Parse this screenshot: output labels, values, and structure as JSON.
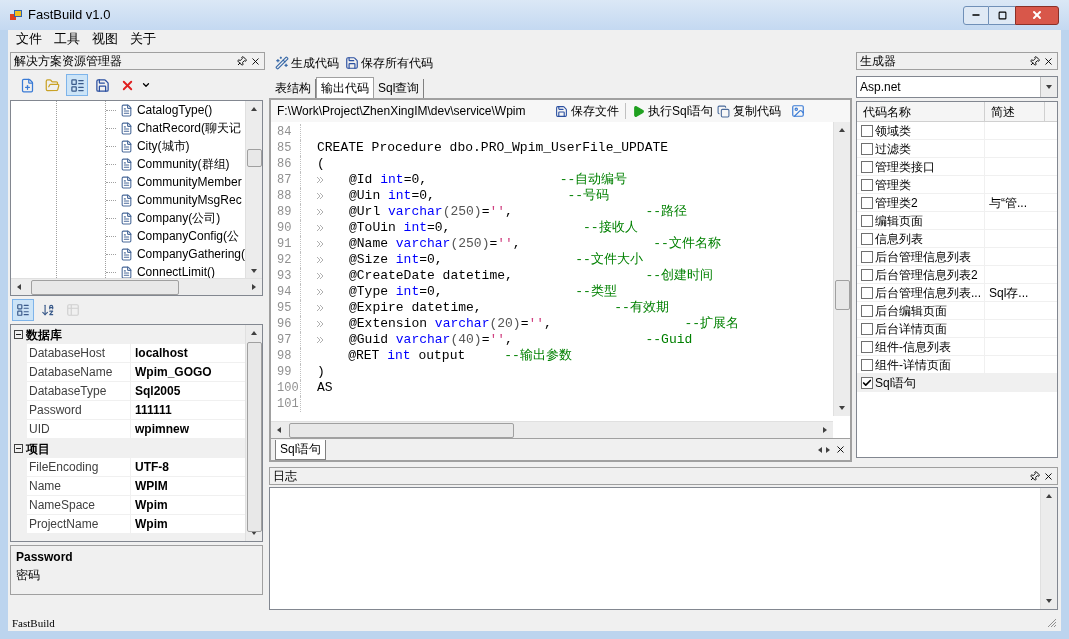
{
  "window": {
    "title": "FastBuild v1.0"
  },
  "menu": [
    "文件",
    "工具",
    "视图",
    "关于"
  ],
  "solution_explorer": {
    "title": "解决方案资源管理器",
    "toolbar": [
      {
        "kind": "new-project",
        "selected": false
      },
      {
        "kind": "open-folder",
        "selected": false
      },
      {
        "kind": "properties",
        "selected": true
      },
      {
        "kind": "save",
        "selected": false
      },
      {
        "kind": "delete",
        "selected": false
      }
    ],
    "tree_items": [
      "CatalogType()",
      "ChatRecord(聊天记",
      "City(城市)",
      "Community(群组)",
      "CommunityMember",
      "CommunityMsgRec",
      "Company(公司)",
      "CompanyConfig(公",
      "CompanyGathering(",
      "ConnectLimit()"
    ]
  },
  "properties": {
    "toolbar": [
      {
        "kind": "categorized",
        "selected": true,
        "disabled": false
      },
      {
        "kind": "alphabetical",
        "selected": false,
        "disabled": false
      },
      {
        "kind": "property-pages",
        "selected": false,
        "disabled": true
      }
    ],
    "categories": [
      {
        "name": "数据库",
        "expanded": true,
        "rows": [
          {
            "name": "DatabaseHost",
            "value": "localhost"
          },
          {
            "name": "DatabaseName",
            "value": "Wpim_GOGO"
          },
          {
            "name": "DatabaseType",
            "value": "Sql2005"
          },
          {
            "name": "Password",
            "value": "111111"
          },
          {
            "name": "UID",
            "value": "wpimnew"
          }
        ]
      },
      {
        "name": "项目",
        "expanded": true,
        "rows": [
          {
            "name": "FileEncoding",
            "value": "UTF-8"
          },
          {
            "name": "Name",
            "value": "WPIM"
          },
          {
            "name": "NameSpace",
            "value": "Wpim"
          },
          {
            "name": "ProjectName",
            "value": "Wpim"
          }
        ]
      }
    ],
    "description": {
      "title": "Password",
      "text": "密码"
    }
  },
  "main_toolbar": [
    {
      "kind": "generate",
      "label": "生成代码"
    },
    {
      "kind": "save-all",
      "label": "保存所有代码"
    }
  ],
  "tabs": [
    {
      "label": "表结构",
      "selected": false
    },
    {
      "label": "输出代码",
      "selected": true
    },
    {
      "label": "Sql查询",
      "selected": false
    }
  ],
  "editor": {
    "path": "F:\\Work\\Project\\ZhenXingIM\\dev\\service\\Wpim",
    "toolbar": [
      {
        "kind": "save",
        "label": "保存文件"
      },
      {
        "kind": "run",
        "label": "执行Sql语句"
      },
      {
        "kind": "copy",
        "label": "复制代码"
      },
      {
        "kind": "image"
      }
    ],
    "lines": [
      {
        "number": "84",
        "tab": false
      },
      {
        "number": "85",
        "tab": false,
        "tokens": [
          {
            "kind": "plain",
            "text": "CREATE Procedure dbo.PRO_Wpim_UserFile_UPDATE"
          }
        ]
      },
      {
        "number": "86",
        "tab": false,
        "tokens": [
          {
            "kind": "plain",
            "text": "("
          }
        ]
      },
      {
        "number": "87",
        "tab": true,
        "tokens": [
          {
            "kind": "plain",
            "text": "@Id "
          },
          {
            "kind": "keyword",
            "text": "int"
          },
          {
            "kind": "plain",
            "text": "=0,"
          }
        ],
        "comment": "                 --自动编号"
      },
      {
        "number": "88",
        "tab": true,
        "tokens": [
          {
            "kind": "plain",
            "text": "@Uin "
          },
          {
            "kind": "keyword",
            "text": "int"
          },
          {
            "kind": "plain",
            "text": "=0,"
          }
        ],
        "comment": "                 --号码"
      },
      {
        "number": "89",
        "tab": true,
        "tokens": [
          {
            "kind": "plain",
            "text": "@Url "
          },
          {
            "kind": "keyword",
            "text": "varchar"
          },
          {
            "kind": "number",
            "text": "(250)"
          },
          {
            "kind": "plain",
            "text": "="
          },
          {
            "kind": "string",
            "text": "''"
          },
          {
            "kind": "plain",
            "text": ","
          }
        ],
        "comment": "                 --路径"
      },
      {
        "number": "90",
        "tab": true,
        "tokens": [
          {
            "kind": "plain",
            "text": "@ToUin "
          },
          {
            "kind": "keyword",
            "text": "int"
          },
          {
            "kind": "plain",
            "text": "=0,"
          }
        ],
        "comment": "                 --接收人"
      },
      {
        "number": "91",
        "tab": true,
        "tokens": [
          {
            "kind": "plain",
            "text": "@Name "
          },
          {
            "kind": "keyword",
            "text": "varchar"
          },
          {
            "kind": "number",
            "text": "(250)"
          },
          {
            "kind": "plain",
            "text": "="
          },
          {
            "kind": "string",
            "text": "''"
          },
          {
            "kind": "plain",
            "text": ","
          }
        ],
        "comment": "                 --文件名称"
      },
      {
        "number": "92",
        "tab": true,
        "tokens": [
          {
            "kind": "plain",
            "text": "@Size "
          },
          {
            "kind": "keyword",
            "text": "int"
          },
          {
            "kind": "plain",
            "text": "=0,"
          }
        ],
        "comment": "                 --文件大小"
      },
      {
        "number": "93",
        "tab": true,
        "tokens": [
          {
            "kind": "plain",
            "text": "@CreateDate datetime,"
          }
        ],
        "comment": "                 --创建时间"
      },
      {
        "number": "94",
        "tab": true,
        "tokens": [
          {
            "kind": "plain",
            "text": "@Type "
          },
          {
            "kind": "keyword",
            "text": "int"
          },
          {
            "kind": "plain",
            "text": "=0,"
          }
        ],
        "comment": "                 --类型"
      },
      {
        "number": "95",
        "tab": true,
        "tokens": [
          {
            "kind": "plain",
            "text": "@Expire datetime,"
          }
        ],
        "comment": "                 --有效期"
      },
      {
        "number": "96",
        "tab": true,
        "tokens": [
          {
            "kind": "plain",
            "text": "@Extension "
          },
          {
            "kind": "keyword",
            "text": "varchar"
          },
          {
            "kind": "number",
            "text": "(20)"
          },
          {
            "kind": "plain",
            "text": "="
          },
          {
            "kind": "string",
            "text": "''"
          },
          {
            "kind": "plain",
            "text": ","
          }
        ],
        "comment": "                 --扩展名"
      },
      {
        "number": "97",
        "tab": true,
        "tokens": [
          {
            "kind": "plain",
            "text": "@Guid "
          },
          {
            "kind": "keyword",
            "text": "varchar"
          },
          {
            "kind": "number",
            "text": "(40)"
          },
          {
            "kind": "plain",
            "text": "="
          },
          {
            "kind": "string",
            "text": "''"
          },
          {
            "kind": "plain",
            "text": ","
          }
        ],
        "comment": "                 --Guid"
      },
      {
        "number": "98",
        "tab": false,
        "tokens": [
          {
            "kind": "plain",
            "text": "    @RET "
          },
          {
            "kind": "keyword",
            "text": "int"
          },
          {
            "kind": "plain",
            "text": " output"
          }
        ],
        "comment": "     --输出参数"
      },
      {
        "number": "99",
        "tab": false,
        "tokens": [
          {
            "kind": "plain",
            "text": ")"
          }
        ]
      },
      {
        "number": "100",
        "tab": false,
        "tokens": [
          {
            "kind": "plain",
            "text": "AS"
          }
        ]
      },
      {
        "number": "101",
        "tab": false
      }
    ],
    "doc_tabs": [
      {
        "label": "Sql语句",
        "selected": true
      }
    ]
  },
  "generator": {
    "title": "生成器",
    "framework": "Asp.net",
    "columns": [
      "代码名称",
      "简述"
    ],
    "items": [
      {
        "name": "领域类",
        "checked": false,
        "selected": false
      },
      {
        "name": "过滤类",
        "checked": false,
        "selected": false
      },
      {
        "name": "管理类接口",
        "checked": false,
        "selected": false
      },
      {
        "name": "管理类",
        "checked": false,
        "selected": false
      },
      {
        "name": "管理类2",
        "description": "与“管...",
        "checked": false,
        "selected": false
      },
      {
        "name": "编辑页面",
        "checked": false,
        "selected": false
      },
      {
        "name": "信息列表",
        "checked": false,
        "selected": false
      },
      {
        "name": "后台管理信息列表",
        "checked": false,
        "selected": false
      },
      {
        "name": "后台管理信息列表2",
        "checked": false,
        "selected": false
      },
      {
        "name": "后台管理信息列表...",
        "description": "Sql存...",
        "checked": false,
        "selected": false
      },
      {
        "name": "后台编辑页面",
        "checked": false,
        "selected": false
      },
      {
        "name": "后台详情页面",
        "checked": false,
        "selected": false
      },
      {
        "name": "组件-信息列表",
        "checked": false,
        "selected": false
      },
      {
        "name": "组件-详情页面",
        "checked": false,
        "selected": false
      },
      {
        "name": "Sql语句",
        "checked": true,
        "selected": true
      }
    ]
  },
  "log": {
    "title": "日志"
  },
  "status_bar": {
    "text": "FastBuild"
  }
}
